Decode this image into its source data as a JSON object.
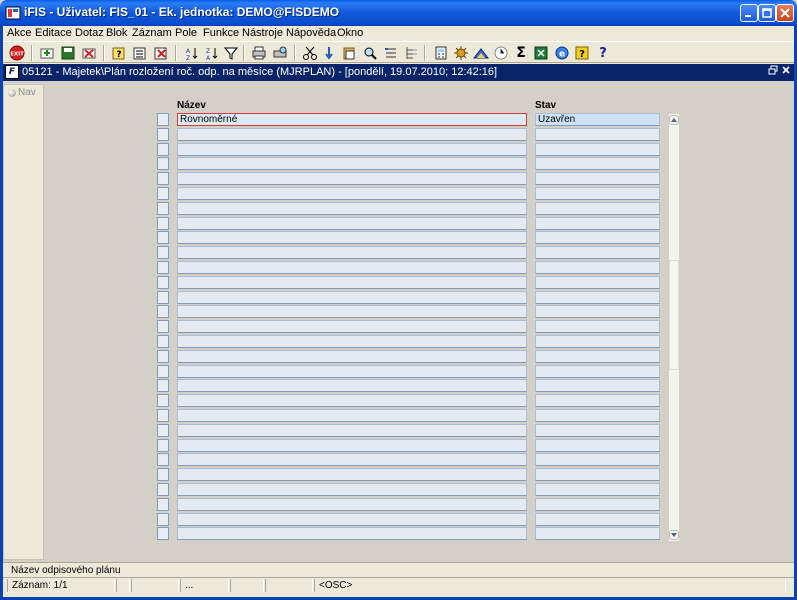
{
  "window": {
    "title": "iFIS - Uživatel: FIS_01 - Ek. jednotka: DEMO@FISDEMO",
    "brand_color": "#0a5ee8"
  },
  "menu": [
    "Akce",
    "Editace",
    "Dotaz",
    "Blok",
    "Záznam",
    "Pole",
    "Funkce",
    "Nástroje",
    "Nápověda",
    "Okno"
  ],
  "toolbar": {
    "exit_label": "EXIT",
    "sum_glyph": "Σ",
    "help_glyph": "?",
    "icons": [
      "exit-icon",
      "add-record-icon",
      "save-icon",
      "delete-record-icon",
      "query-icon",
      "execute-query-icon",
      "cancel-query-icon",
      "sort-asc-icon",
      "sort-desc-icon",
      "filter-icon",
      "print-icon",
      "print-preview-icon",
      "cut-icon",
      "copy-icon",
      "paste-icon",
      "search-icon",
      "list-icon",
      "tree-icon",
      "calculator-icon",
      "settings-icon",
      "chart-icon",
      "clock-icon",
      "sum-icon",
      "excel-icon",
      "browser-icon",
      "help-icon",
      "context-help-icon"
    ]
  },
  "form": {
    "title": "05121 - Majetek\\Plán rozložení roč. odp. na měsíce (MJRPLAN) - [pondělí, 19.07.2010; 12:42:16]",
    "nav_label": "Nav",
    "columns": {
      "name": "Název",
      "state": "Stav"
    },
    "rows": [
      {
        "name": "Rovnoměrné",
        "state": "Uzavřen"
      }
    ],
    "empty_rows": 28
  },
  "status": {
    "hint": "Název odpisového plánu",
    "record": "Záznam: 1/1",
    "dots": "...",
    "mode": "<OSC>"
  }
}
